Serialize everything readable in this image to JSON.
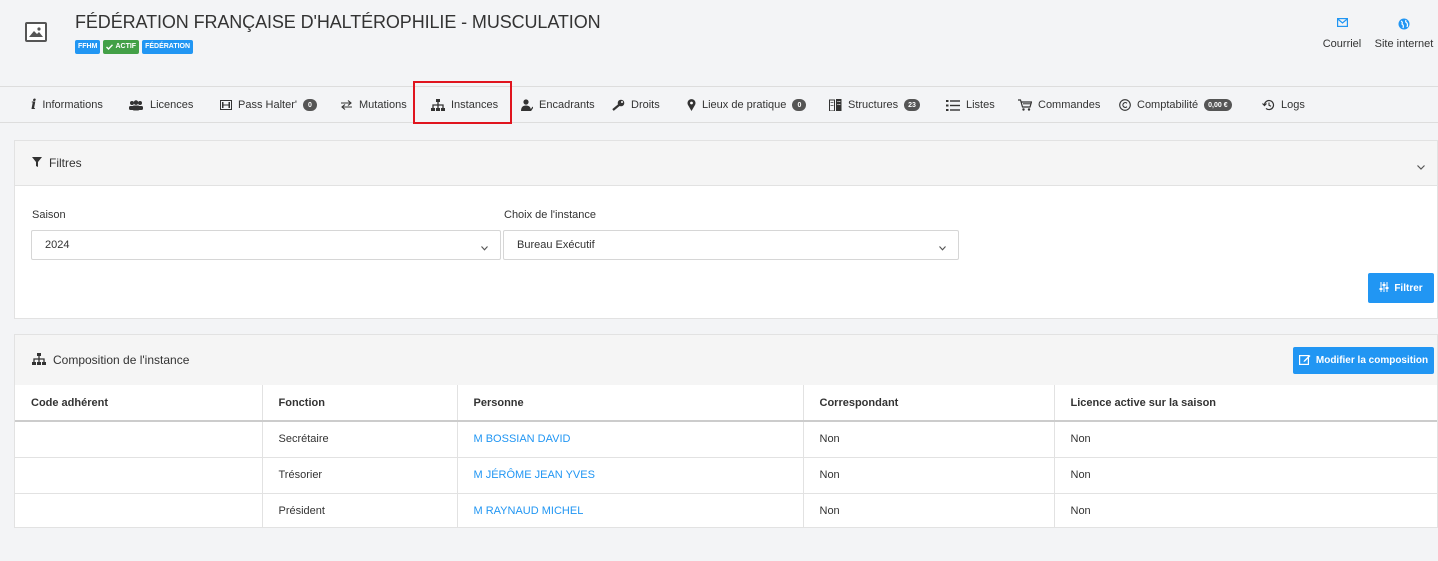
{
  "org": {
    "title": "FÉDÉRATION FRANÇAISE D'HALTÉROPHILIE - MUSCULATION",
    "badges": [
      {
        "label": "FFHM",
        "color": "#2196f3"
      },
      {
        "label": "ACTIF",
        "color": "#43a047",
        "icon": "check-icon"
      },
      {
        "label": "FÉDÉRATION",
        "color": "#2196f3"
      }
    ]
  },
  "header_actions": {
    "email": {
      "label": "Courriel",
      "icon": "envelope-icon"
    },
    "website": {
      "label": "Site internet",
      "icon": "globe-icon"
    }
  },
  "tabs": [
    {
      "label": "Informations",
      "icon": "info-icon"
    },
    {
      "label": "Licences",
      "icon": "users-icon"
    },
    {
      "label": "Pass Halter'",
      "icon": "barbell-icon",
      "count": "0"
    },
    {
      "label": "Mutations",
      "icon": "exchange-icon"
    },
    {
      "label": "Instances",
      "icon": "sitemap-icon",
      "active": true
    },
    {
      "label": "Encadrants",
      "icon": "user-tie-icon"
    },
    {
      "label": "Droits",
      "icon": "key-icon"
    },
    {
      "label": "Lieux de pratique",
      "icon": "map-marker-icon",
      "count": "0"
    },
    {
      "label": "Structures",
      "icon": "building-icon",
      "count": "23"
    },
    {
      "label": "Listes",
      "icon": "list-icon"
    },
    {
      "label": "Commandes",
      "icon": "cart-icon"
    },
    {
      "label": "Comptabilité",
      "icon": "copyright-icon",
      "count": "0,00 €"
    },
    {
      "label": "Logs",
      "icon": "history-icon"
    }
  ],
  "filters": {
    "title": "Filtres",
    "season": {
      "label": "Saison",
      "value": "2024"
    },
    "instance": {
      "label": "Choix de l'instance",
      "value": "Bureau Exécutif"
    },
    "button": "Filtrer"
  },
  "composition": {
    "title": "Composition de l'instance",
    "edit_button": "Modifier la composition",
    "columns": [
      "Code adhérent",
      "Fonction",
      "Personne",
      "Correspondant",
      "Licence active sur la saison"
    ],
    "rows": [
      {
        "code": "",
        "fonction": "Secrétaire",
        "personne": "M BOSSIAN DAVID",
        "correspondant": "Non",
        "licence": "Non"
      },
      {
        "code": "",
        "fonction": "Trésorier",
        "personne": "M JÉRÔME JEAN YVES",
        "correspondant": "Non",
        "licence": "Non"
      },
      {
        "code": "",
        "fonction": "Président",
        "personne": "M RAYNAUD MICHEL",
        "correspondant": "Non",
        "licence": "Non"
      }
    ]
  },
  "colors": {
    "accent": "#2196f3",
    "active_tab_outline": "#e0141e",
    "badge_green": "#43a047"
  }
}
